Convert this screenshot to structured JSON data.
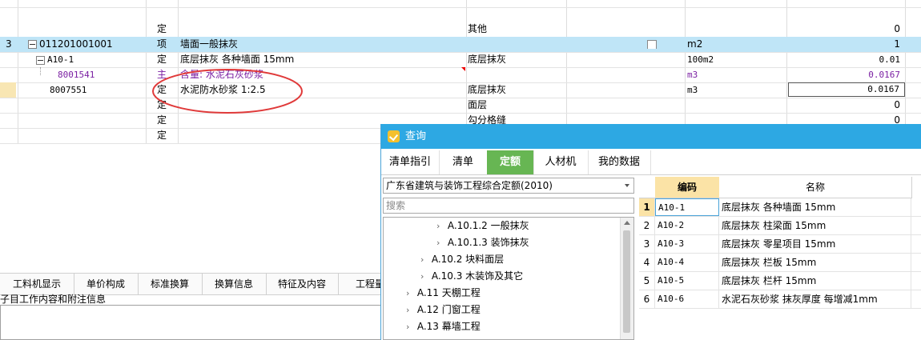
{
  "grid": {
    "rows": [
      {
        "num": "",
        "code": "",
        "type": "",
        "name": "",
        "spec": "",
        "unit": "",
        "qty": ""
      },
      {
        "num": "",
        "code": "",
        "type": "定",
        "name": "",
        "spec": "其他",
        "unit": "",
        "qty": "0"
      },
      {
        "num": "3",
        "code": "011201001001",
        "type": "项",
        "name": "墙面一般抹灰",
        "spec": "",
        "unit": "m2",
        "qty": "1"
      },
      {
        "num": "",
        "code": "A10-1",
        "type": "定",
        "name": "底层抹灰 各种墙面 15mm",
        "spec": "底层抹灰",
        "unit": "100m2",
        "qty": "0.01"
      },
      {
        "num": "",
        "code": "8001541",
        "type": "主",
        "name": "含量: 水泥石灰砂浆",
        "spec": "",
        "unit": "m3",
        "qty": "0.0167"
      },
      {
        "num": "",
        "code": "8007551",
        "type": "定",
        "name": "水泥防水砂浆 1:2.5",
        "spec": "底层抹灰",
        "unit": "m3",
        "qty": "0.0167"
      },
      {
        "num": "",
        "code": "",
        "type": "定",
        "name": "",
        "spec": "面层",
        "unit": "",
        "qty": "0"
      },
      {
        "num": "",
        "code": "",
        "type": "定",
        "name": "",
        "spec": "勾分格缝",
        "unit": "",
        "qty": "0"
      },
      {
        "num": "",
        "code": "",
        "type": "定",
        "name": "",
        "spec": "",
        "unit": "",
        "qty": ""
      }
    ]
  },
  "bottom": {
    "tabs": [
      "工料机显示",
      "单价构成",
      "标准换算",
      "换算信息",
      "特征及内容",
      "工程量"
    ],
    "work_info": "子目工作内容和附注信息"
  },
  "dialog": {
    "title": "查询",
    "tabs": [
      "清单指引",
      "清单",
      "定额",
      "人材机",
      "我的数据"
    ],
    "active_tab": "定额",
    "quota_library": "广东省建筑与装饰工程综合定额(2010)",
    "search_placeholder": "搜索",
    "tree": [
      {
        "label": "A.10.1.2 一般抹灰",
        "level": 3
      },
      {
        "label": "A.10.1.3 装饰抹灰",
        "level": 3
      },
      {
        "label": "A.10.2 块料面层",
        "level": 2
      },
      {
        "label": "A.10.3 木装饰及其它",
        "level": 2
      },
      {
        "label": "A.11 天棚工程",
        "level": 1
      },
      {
        "label": "A.12 门窗工程",
        "level": 1
      },
      {
        "label": "A.13 幕墙工程",
        "level": 1
      }
    ],
    "results": {
      "headers": {
        "code": "编码",
        "name": "名称"
      },
      "rows": [
        {
          "idx": "1",
          "code": "A10-1",
          "name": "底层抹灰 各种墙面 15mm"
        },
        {
          "idx": "2",
          "code": "A10-2",
          "name": "底层抹灰 柱梁面 15mm"
        },
        {
          "idx": "3",
          "code": "A10-3",
          "name": "底层抹灰 零星项目 15mm"
        },
        {
          "idx": "4",
          "code": "A10-4",
          "name": "底层抹灰 栏板 15mm"
        },
        {
          "idx": "5",
          "code": "A10-5",
          "name": "底层抹灰 栏杆 15mm"
        },
        {
          "idx": "6",
          "code": "A10-6",
          "name": "水泥石灰砂浆 抹灰厚度 每增减1mm"
        }
      ]
    }
  },
  "colors": {
    "selected_row": "#bfe5f7",
    "dialog_title": "#2da8e3",
    "active_tab": "#67b653",
    "highlight_ellipse": "#e03a3a",
    "main_material_text": "#7a1fa2"
  }
}
